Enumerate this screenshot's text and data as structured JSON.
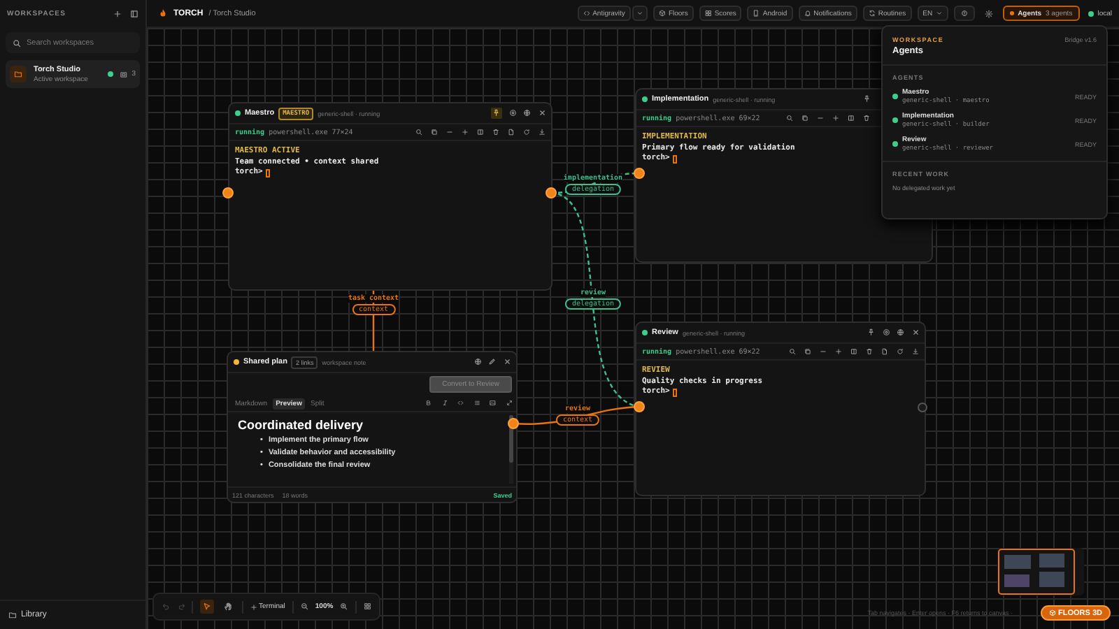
{
  "sidebar": {
    "title": "WORKSPACES",
    "search_placeholder": "Search workspaces",
    "workspaces": [
      {
        "name": "Torch Studio",
        "subtitle": "Active workspace",
        "selected": true,
        "online": true,
        "count": "3"
      }
    ],
    "library": "Library"
  },
  "topbar": {
    "logo": "TORCH",
    "breadcrumb": "/ Torch Studio",
    "actions": [
      {
        "label": "Antigravity",
        "dropdown": true
      },
      {
        "label": "Floors",
        "dropdown": false
      },
      {
        "label": "Scores",
        "dropdown": false
      },
      {
        "label": "Android",
        "dropdown": false
      },
      {
        "label": "Notifications",
        "dropdown": false
      },
      {
        "label": "Routines",
        "dropdown": false
      }
    ],
    "language": "EN",
    "agents": {
      "label": "Agents",
      "count": "3 agents",
      "open": true
    },
    "connection": {
      "label": "local",
      "online": true
    }
  },
  "nodes": [
    {
      "kind": "terminal",
      "color": "#3ecf8e",
      "title": "Maestro",
      "badge": "MAESTRO",
      "subtitle": "generic-shell · running",
      "pinned": true,
      "status": "running",
      "process": "powershell.exe 77×24",
      "lines": [
        {
          "kind": "heading",
          "text": "MAESTRO ACTIVE"
        },
        {
          "kind": "text",
          "text": "Team connected • context shared"
        }
      ],
      "prompt": "torch>"
    },
    {
      "kind": "terminal",
      "color": "#3ecf8e",
      "title": "Implementation",
      "subtitle": "generic-shell · running",
      "pinned": false,
      "status": "running",
      "process": "powershell.exe 69×22",
      "lines": [
        {
          "kind": "heading",
          "text": "IMPLEMENTATION"
        },
        {
          "kind": "text",
          "text": "Primary flow ready for validation"
        }
      ],
      "prompt": "torch>"
    },
    {
      "kind": "note",
      "color": "#f5b731",
      "title": "Shared plan",
      "badge": "2 links",
      "subtitle": "workspace note",
      "action": {
        "label": "Convert to Review",
        "disabled": true
      },
      "tabs": [
        {
          "label": "Markdown",
          "selected": false
        },
        {
          "label": "Preview",
          "selected": true
        },
        {
          "label": "Split",
          "selected": false
        }
      ],
      "heading": "Coordinated delivery",
      "items": [
        {
          "marker": "•",
          "text": "Implement the primary flow"
        },
        {
          "marker": "•",
          "text": "Validate behavior and accessibility"
        },
        {
          "marker": "•",
          "text": "Consolidate the final review"
        }
      ],
      "stats": [
        "121 characters",
        "18 words"
      ],
      "save_state": "Saved"
    },
    {
      "kind": "terminal",
      "color": "#3ecf8e",
      "title": "Review",
      "subtitle": "generic-shell · running",
      "pinned": false,
      "status": "running",
      "process": "powershell.exe 69×22",
      "lines": [
        {
          "kind": "heading",
          "text": "REVIEW"
        },
        {
          "kind": "text",
          "text": "Quality checks in progress"
        }
      ],
      "prompt": "torch>"
    }
  ],
  "edges": [
    {
      "kind": "delegation",
      "label": "implementation",
      "tag": "delegation"
    },
    {
      "kind": "delegation",
      "label": "review",
      "tag": "delegation"
    },
    {
      "kind": "context",
      "label": "task context",
      "tag": "context"
    },
    {
      "kind": "context",
      "label": "review",
      "tag": "context"
    }
  ],
  "agents_panel": {
    "eyebrow": "WORKSPACE",
    "title": "Agents",
    "version": "Bridge v1.6",
    "section": "AGENTS",
    "agents": [
      {
        "name": "Maestro",
        "detail": "generic-shell · maestro",
        "status": "READY"
      },
      {
        "name": "Implementation",
        "detail": "generic-shell · builder",
        "status": "READY"
      },
      {
        "name": "Review",
        "detail": "generic-shell · reviewer",
        "status": "READY"
      }
    ],
    "recent_title": "RECENT WORK",
    "recent_empty": "No delegated work yet"
  },
  "toolbar": {
    "history": [
      {
        "kind": "undo",
        "disabled": true
      },
      {
        "kind": "redo",
        "disabled": true
      }
    ],
    "tools": [
      {
        "kind": "select",
        "selected": true
      },
      {
        "kind": "pan",
        "selected": false
      }
    ],
    "add_label": "Terminal",
    "zoom": "100%"
  },
  "hint": "Tab navigates · Enter opens · F6 returns to canvas ·",
  "floors_button": "FLOORS 3D"
}
